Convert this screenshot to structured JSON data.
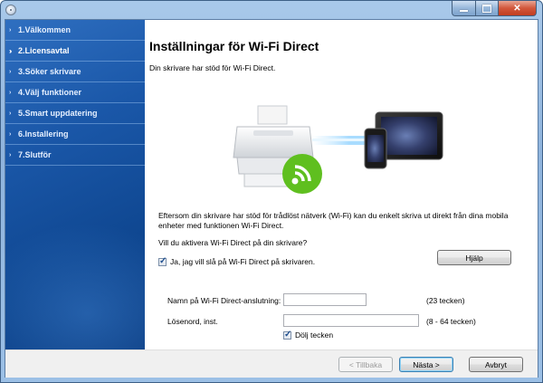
{
  "window": {
    "close_glyph": "✕"
  },
  "sidebar": {
    "items": [
      {
        "label": "1.Välkommen",
        "marker": "›"
      },
      {
        "label": "2.Licensavtal",
        "marker": "››"
      },
      {
        "label": "3.Söker skrivare",
        "marker": "›"
      },
      {
        "label": "4.Välj funktioner",
        "marker": "›"
      },
      {
        "label": "5.Smart uppdatering",
        "marker": "›"
      },
      {
        "label": "6.Installering",
        "marker": "›"
      },
      {
        "label": "7.Slutför",
        "marker": "›"
      }
    ],
    "active_index": 1
  },
  "main": {
    "title": "Inställningar för Wi-Fi Direct",
    "subtitle": "Din skrivare har stöd för Wi-Fi Direct.",
    "description": "Eftersom din skrivare har stöd för trådlöst nätverk (Wi-Fi) kan du enkelt skriva ut direkt från dina mobila enheter med funktionen Wi-Fi Direct.",
    "question": "Vill du aktivera Wi-Fi Direct på din skrivare?",
    "help_label": "Hjälp",
    "enable_checkbox": {
      "label": "Ja, jag vill slå på Wi-Fi Direct på skrivaren.",
      "checked": true
    },
    "name_field": {
      "label": "Namn på Wi-Fi Direct-anslutning:",
      "value": "",
      "hint": "(23 tecken)"
    },
    "password_field": {
      "label": "Lösenord, inst.",
      "value": "",
      "hint": "(8 - 64 tecken)"
    },
    "hide_checkbox": {
      "label": "Dölj tecken",
      "checked": true
    }
  },
  "footer": {
    "back_label": "< Tillbaka",
    "next_label": "Nästa >",
    "cancel_label": "Avbryt"
  },
  "colors": {
    "sidebar": "#1a57a8",
    "wifi_green": "#5fbf1f"
  }
}
